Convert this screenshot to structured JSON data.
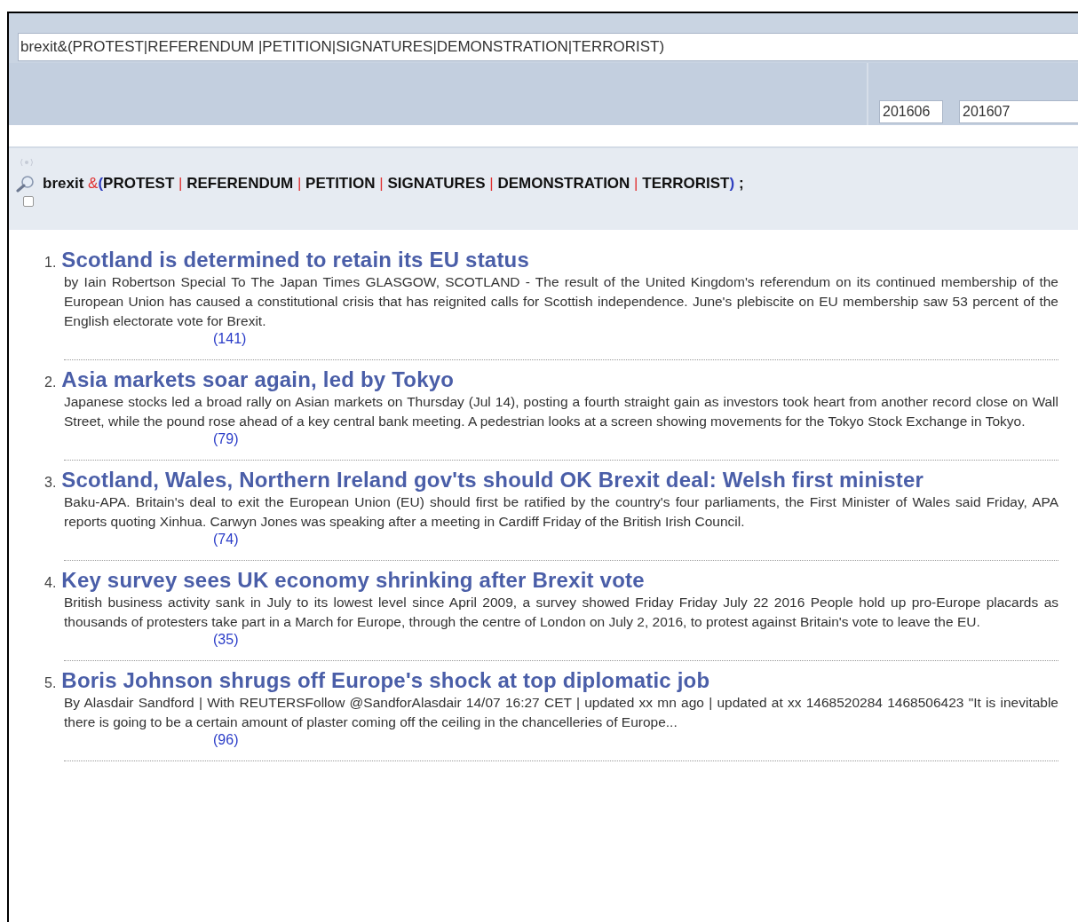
{
  "search": {
    "value": "brexit&(PROTEST|REFERENDUM |PETITION|SIGNATURES|DEMONSTRATION|TERRORIST)"
  },
  "date_range": {
    "from": "201606",
    "to": "201607"
  },
  "query_tokens": [
    {
      "kind": "term",
      "text": "brexit"
    },
    {
      "kind": "operator",
      "text": "&"
    },
    {
      "kind": "paren",
      "text": "("
    },
    {
      "kind": "term",
      "text": "PROTEST"
    },
    {
      "kind": "operator",
      "text": "|"
    },
    {
      "kind": "term",
      "text": "REFERENDUM"
    },
    {
      "kind": "operator",
      "text": "|"
    },
    {
      "kind": "term",
      "text": "PETITION"
    },
    {
      "kind": "operator",
      "text": "|"
    },
    {
      "kind": "term",
      "text": "SIGNATURES"
    },
    {
      "kind": "operator",
      "text": "|"
    },
    {
      "kind": "term",
      "text": "DEMONSTRATION"
    },
    {
      "kind": "operator",
      "text": "|"
    },
    {
      "kind": "term",
      "text": "TERRORIST"
    },
    {
      "kind": "paren",
      "text": ")"
    },
    {
      "kind": "term",
      "text": ";"
    }
  ],
  "select_checkbox": {
    "checked": false
  },
  "results": [
    {
      "number": "1.",
      "title": "Scotland is determined to retain its EU status",
      "snippet": "by Iain Robertson Special To The Japan Times GLASGOW, SCOTLAND - The result of the United Kingdom's referendum on its continued membership of the European Union has caused a constitutional crisis that has reignited calls for Scottish independence. June's plebiscite on EU membership saw 53 percent of the English electorate vote for Brexit.",
      "count": "(141)"
    },
    {
      "number": "2.",
      "title": "Asia markets soar again, led by Tokyo",
      "snippet": "Japanese stocks led a broad rally on Asian markets on Thursday (Jul 14), posting a fourth straight gain as investors took heart from another record close on Wall Street, while the pound rose ahead of a key central bank meeting. A pedestrian looks at a screen showing movements for the Tokyo Stock Exchange in Tokyo.",
      "count": "(79)"
    },
    {
      "number": "3.",
      "title": "Scotland, Wales, Northern Ireland gov'ts should OK Brexit deal: Welsh first minister",
      "snippet": "Baku-APA. Britain's deal to exit the European Union (EU) should first be ratified by the country's four parliaments, the First Minister of Wales said Friday, APA reports quoting Xinhua. Carwyn Jones was speaking after a meeting in Cardiff Friday of the British Irish Council.",
      "count": "(74)"
    },
    {
      "number": "4.",
      "title": "Key survey sees UK economy shrinking after Brexit vote",
      "snippet": "British business activity sank in July to its lowest level since April 2009, a survey showed Friday Friday July 22 2016 People hold up pro-Europe placards as thousands of protesters take part in a March for Europe, through the centre of London on July 2, 2016, to protest against Britain's vote to leave the EU.",
      "count": "(35)"
    },
    {
      "number": "5.",
      "title": "Boris Johnson shrugs off Europe's shock at top diplomatic job",
      "snippet": "By Alasdair Sandford | With REUTERSFollow @SandforAlasdair 14/07 16:27 CET | updated xx mn ago | updated at xx 1468520284 1468506423 \"It is inevitable there is going to be a certain amount of plaster coming off the ceiling in the chancelleries of Europe...",
      "count": "(96)"
    }
  ]
}
